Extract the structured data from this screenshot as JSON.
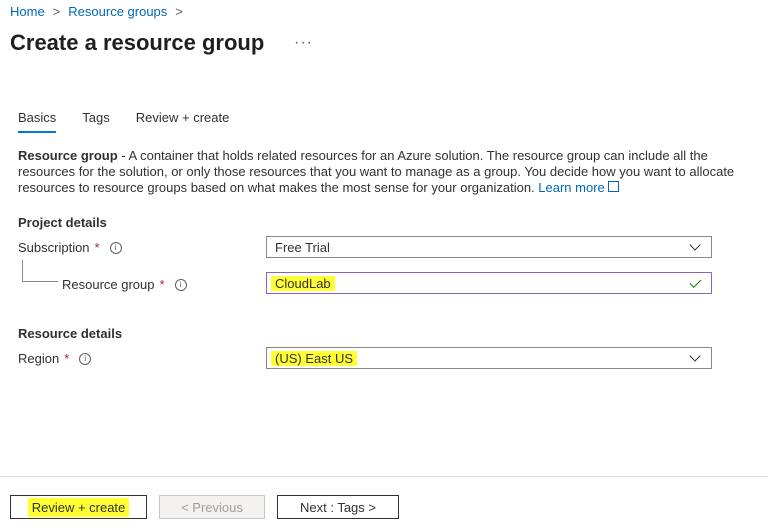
{
  "breadcrumb": {
    "home": "Home",
    "resource_groups": "Resource groups",
    "sep": ">"
  },
  "page": {
    "title": "Create a resource group",
    "more": "···"
  },
  "tabs": [
    {
      "label": "Basics",
      "active": true
    },
    {
      "label": "Tags",
      "active": false
    },
    {
      "label": "Review + create",
      "active": false
    }
  ],
  "description": {
    "term": "Resource group",
    "text": " - A container that holds related resources for an Azure solution. The resource group can include all the resources for the solution, or only those resources that you want to manage as a group. You decide how you want to allocate resources to resource groups based on what makes the most sense for your organization. ",
    "link": "Learn more"
  },
  "project_details": {
    "heading": "Project details",
    "subscription": {
      "label": "Subscription",
      "required": "*",
      "value": "Free Trial"
    },
    "resource_group": {
      "label": "Resource group",
      "required": "*",
      "value": "CloudLab"
    }
  },
  "resource_details": {
    "heading": "Resource details",
    "region": {
      "label": "Region",
      "required": "*",
      "value": "(US) East US"
    }
  },
  "footer": {
    "review_create": "Review + create",
    "previous": "< Previous",
    "next": "Next : Tags >"
  },
  "icons": {
    "info": "i"
  },
  "colors": {
    "link": "#0067b8",
    "highlight": "#ffff33",
    "tab_underline": "#0078d4",
    "required": "#a4262c",
    "valid": "#107c10",
    "focus_border": "#8764b8"
  }
}
